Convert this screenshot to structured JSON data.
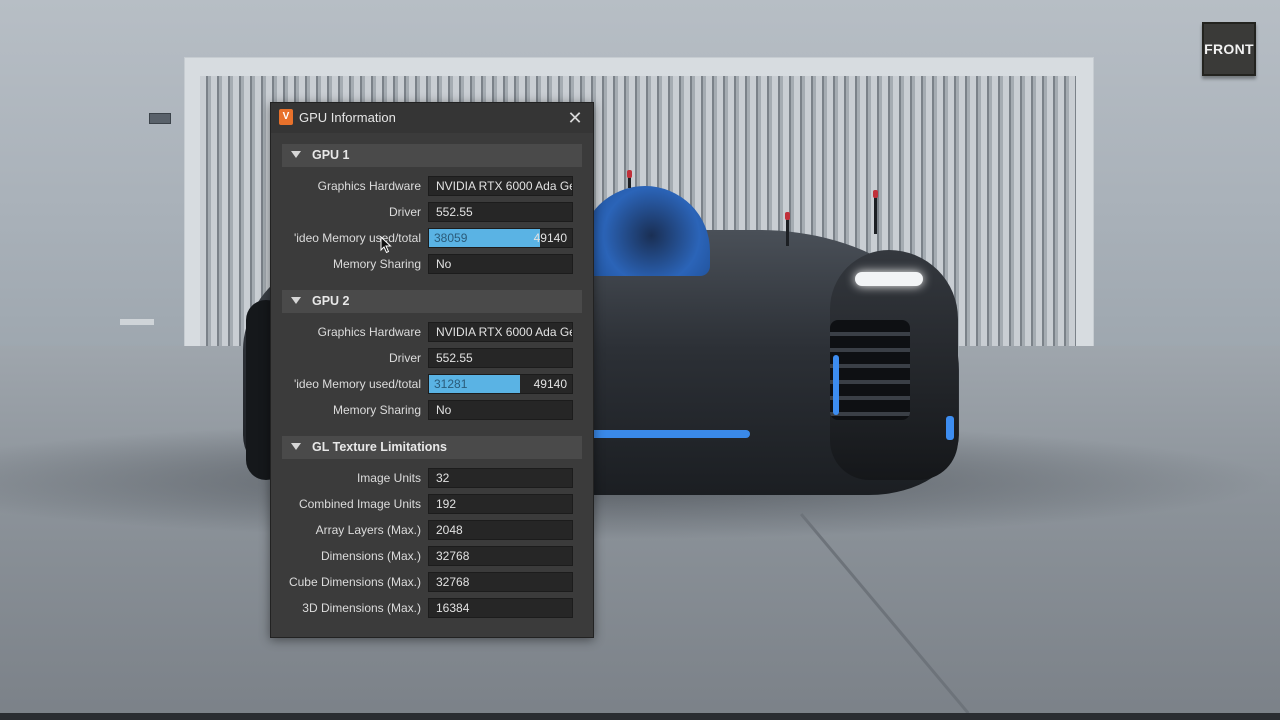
{
  "viewport": {
    "view_label": "FRONT"
  },
  "dialog": {
    "title": "GPU Information",
    "icon_letter": "V",
    "close_glyph": "✕",
    "sections": [
      {
        "title": "GPU 1",
        "rows": {
          "graphics_hardware": {
            "label": "Graphics Hardware",
            "value": "NVIDIA RTX 6000 Ada Ge"
          },
          "driver": {
            "label": "Driver",
            "value": "552.55"
          },
          "video_memory": {
            "label": "'ideo Memory used/total",
            "used": "38059",
            "total": "49140",
            "fraction": 0.7745
          },
          "memory_sharing": {
            "label": "Memory Sharing",
            "value": "No"
          }
        }
      },
      {
        "title": "GPU 2",
        "rows": {
          "graphics_hardware": {
            "label": "Graphics Hardware",
            "value": "NVIDIA RTX 6000 Ada Ge"
          },
          "driver": {
            "label": "Driver",
            "value": "552.55"
          },
          "video_memory": {
            "label": "'ideo Memory used/total",
            "used": "31281",
            "total": "49140",
            "fraction": 0.6366
          },
          "memory_sharing": {
            "label": "Memory Sharing",
            "value": "No"
          }
        }
      },
      {
        "title": "GL Texture Limitations",
        "rows": [
          {
            "label": "Image Units",
            "value": "32"
          },
          {
            "label": "Combined Image Units",
            "value": "192"
          },
          {
            "label": "Array Layers (Max.)",
            "value": "2048"
          },
          {
            "label": "Dimensions (Max.)",
            "value": "32768"
          },
          {
            "label": "Cube Dimensions (Max.)",
            "value": "32768"
          },
          {
            "label": "3D Dimensions (Max.)",
            "value": "16384"
          }
        ]
      }
    ]
  },
  "colors": {
    "memory_bar_fill": "#5ab3e4",
    "dialog_background": "#3b3b3b",
    "app_icon": "#e8712b"
  }
}
